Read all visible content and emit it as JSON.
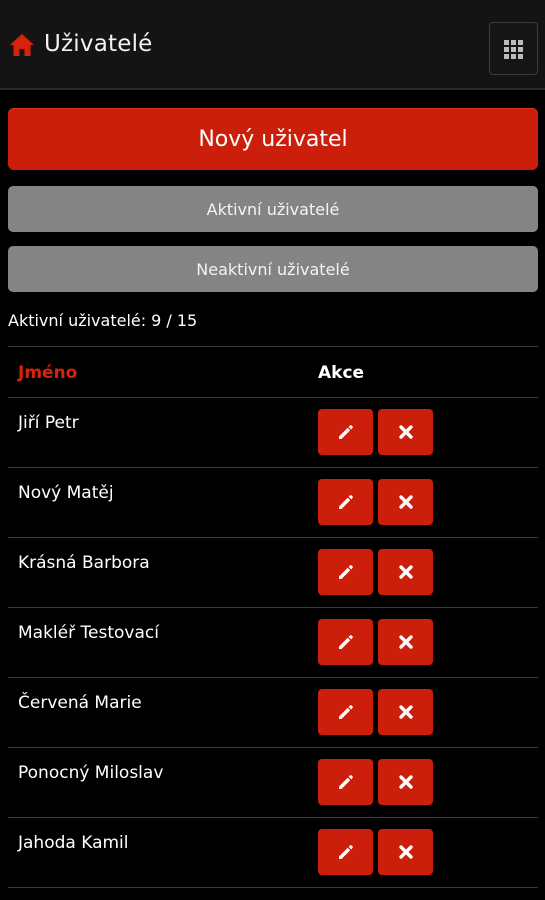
{
  "header": {
    "title": "Uživatelé",
    "home_icon": "home-icon",
    "menu_icon": "grid-icon"
  },
  "buttons": {
    "new_user": "Nový uživatel",
    "active_users": "Aktivní uživatelé",
    "inactive_users": "Neaktivní uživatelé"
  },
  "summary": {
    "label": "Aktivní uživatelé:",
    "value": "9 / 15"
  },
  "table": {
    "columns": {
      "name": "Jméno",
      "actions": "Akce"
    },
    "rows": [
      {
        "name": "Jiří Petr"
      },
      {
        "name": "Nový Matěj"
      },
      {
        "name": "Krásná Barbora"
      },
      {
        "name": "Makléř Testovací"
      },
      {
        "name": "Červená Marie"
      },
      {
        "name": "Ponocný Miloslav"
      },
      {
        "name": "Jahoda Kamil"
      }
    ],
    "action_icons": {
      "edit": "pencil-icon",
      "delete": "close-icon"
    }
  },
  "colors": {
    "accent": "#cb1f0b",
    "secondary_button": "#848484",
    "header_bg": "#141414",
    "background": "#000000"
  }
}
